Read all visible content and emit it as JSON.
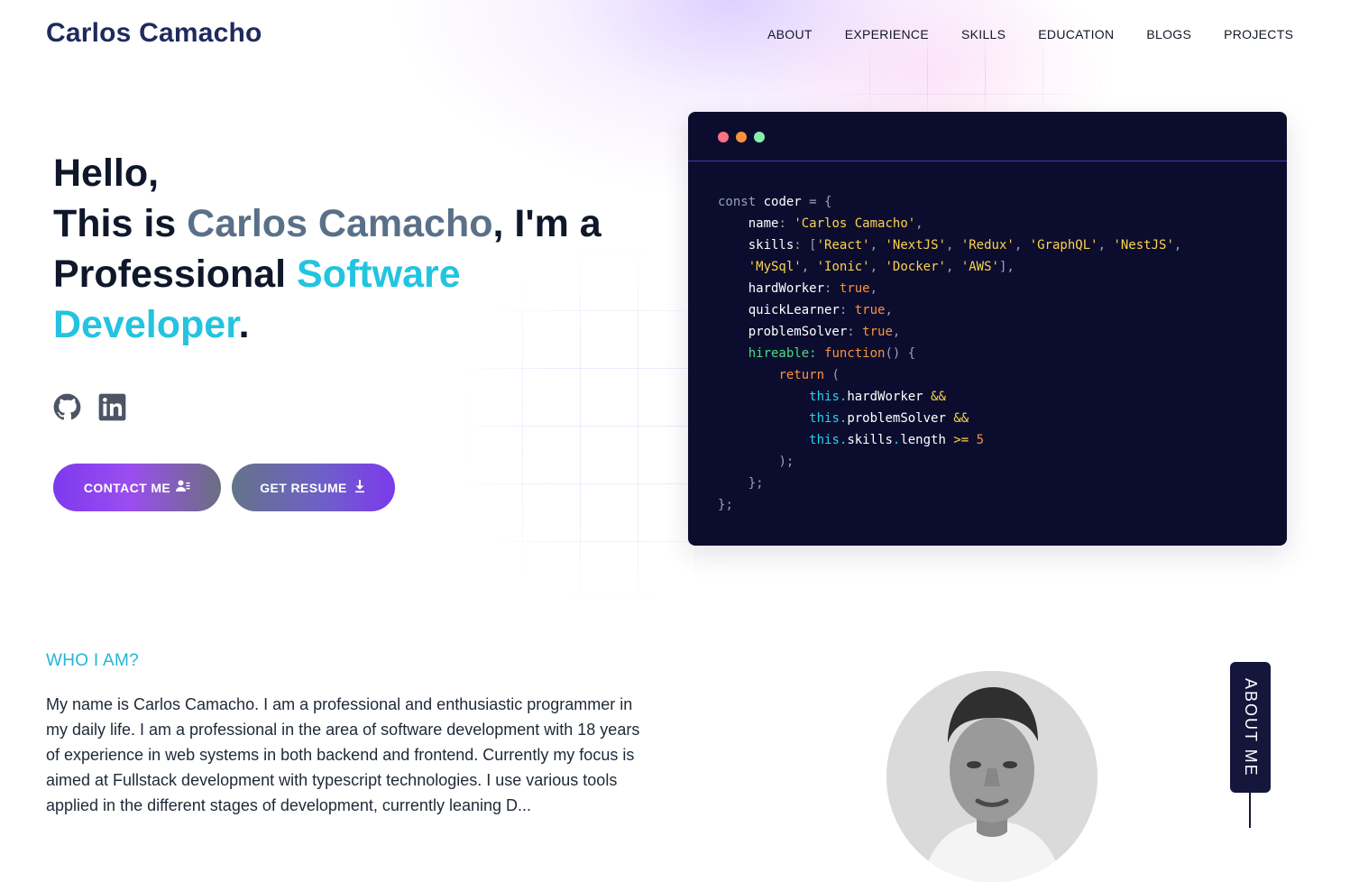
{
  "header": {
    "brand": "Carlos Camacho",
    "nav": [
      "ABOUT",
      "EXPERIENCE",
      "SKILLS",
      "EDUCATION",
      "BLOGS",
      "PROJECTS"
    ]
  },
  "hero": {
    "greeting": "Hello,",
    "intro_prefix": "This is ",
    "name": "Carlos Camacho",
    "intro_suffix": ", I'm a",
    "professional_word": "Professional ",
    "role": "Software Developer",
    "period": ".",
    "social_icons": [
      "github-icon",
      "linkedin-icon"
    ],
    "contact_button": "CONTACT ME",
    "contact_icon": "user-list-icon",
    "resume_button": "GET RESUME",
    "resume_icon": "download-icon"
  },
  "code_card": {
    "window_dots": [
      "#fb7185",
      "#fb923c",
      "#86efac"
    ],
    "lines": [
      "const coder = {",
      "    name: 'Carlos Camacho',",
      "    skills: ['React', 'NextJS', 'Redux', 'GraphQL', 'NestJS',",
      "    'MySql', 'Ionic', 'Docker', 'AWS'],",
      "    hardWorker: true,",
      "    quickLearner: true,",
      "    problemSolver: true,",
      "    hireable: function() {",
      "        return (",
      "            this.hardWorker &&",
      "            this.problemSolver &&",
      "            this.skills.length >= 5",
      "        );",
      "    };",
      "};"
    ]
  },
  "about": {
    "heading": "WHO I AM?",
    "text": "My name is Carlos Camacho. I am a professional and enthusiastic programmer in my daily life. I am a professional in the area of software development with 18 years of experience in web systems in both backend and frontend. Currently my focus is aimed at Fullstack development with typescript technologies. I use various tools applied in the different stages of development, currently leaning D...",
    "side_tab": "ABOUT ME"
  },
  "colors": {
    "brand": "#1f2a5c",
    "name_highlight": "#5a7089",
    "role_highlight": "#22c4df",
    "accent_purple": "#7c3aed",
    "code_bg": "#0c0d2e"
  }
}
